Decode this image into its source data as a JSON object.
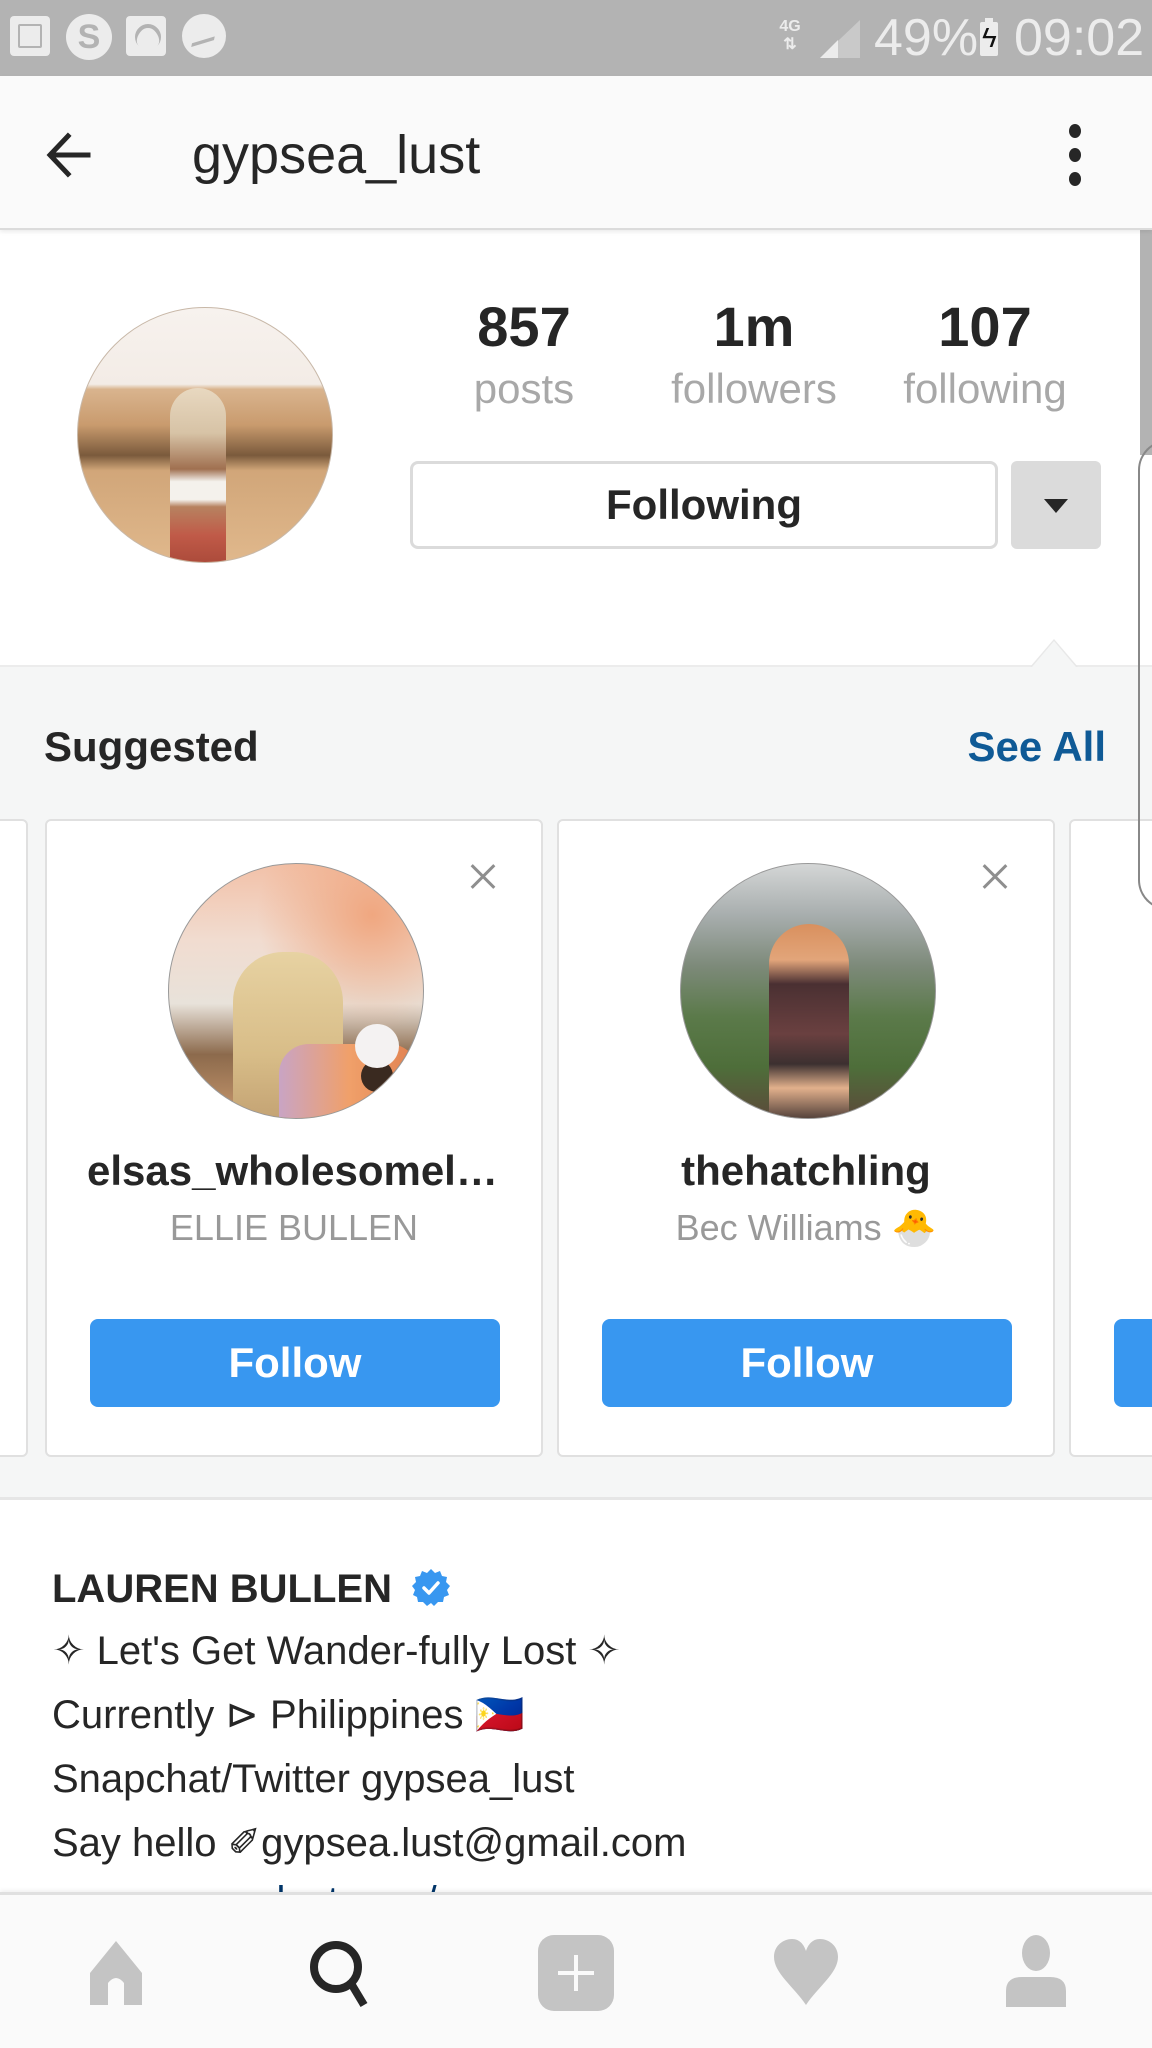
{
  "status_bar": {
    "network": "4G",
    "battery_percent": "49%",
    "time": "09:02",
    "left_icons": [
      "gallery-icon",
      "skype-icon",
      "wifi-icon",
      "messenger-icon"
    ]
  },
  "app_bar": {
    "title": "gypsea_lust",
    "back_icon": "arrow-left-icon",
    "more_icon": "more-vertical-icon"
  },
  "profile": {
    "stats": [
      {
        "value": "857",
        "label": "posts"
      },
      {
        "value": "1m",
        "label": "followers"
      },
      {
        "value": "107",
        "label": "following"
      }
    ],
    "following_button": "Following",
    "dropdown_icon": "caret-down-icon"
  },
  "suggested": {
    "title": "Suggested",
    "see_all": "See All",
    "cards": [
      {
        "username": "elsas_wholesomeli…",
        "full_name": "ELLIE BULLEN",
        "follow_label": "Follow"
      },
      {
        "username": "thehatchling",
        "full_name": "Bec Williams 🐣",
        "follow_label": "Follow"
      }
    ]
  },
  "bio": {
    "name": "LAUREN BULLEN",
    "verified": true,
    "lines": [
      "✧ Let's Get Wander-fully Lost ✧",
      "Currently ⊳ Philippines 🇵🇭",
      "Snapchat/Twitter gypsea_lust",
      "Say hello ✐gypsea.lust@gmail.com"
    ],
    "link": "www.gypsealust.com/"
  },
  "bottom_nav": {
    "items": [
      "home",
      "search",
      "add",
      "activity",
      "profile"
    ],
    "active": "search"
  },
  "colors": {
    "accent": "#3897f0",
    "link": "#0f5a96",
    "verified": "#3897f0",
    "status_bar": "#b3b3b3"
  }
}
